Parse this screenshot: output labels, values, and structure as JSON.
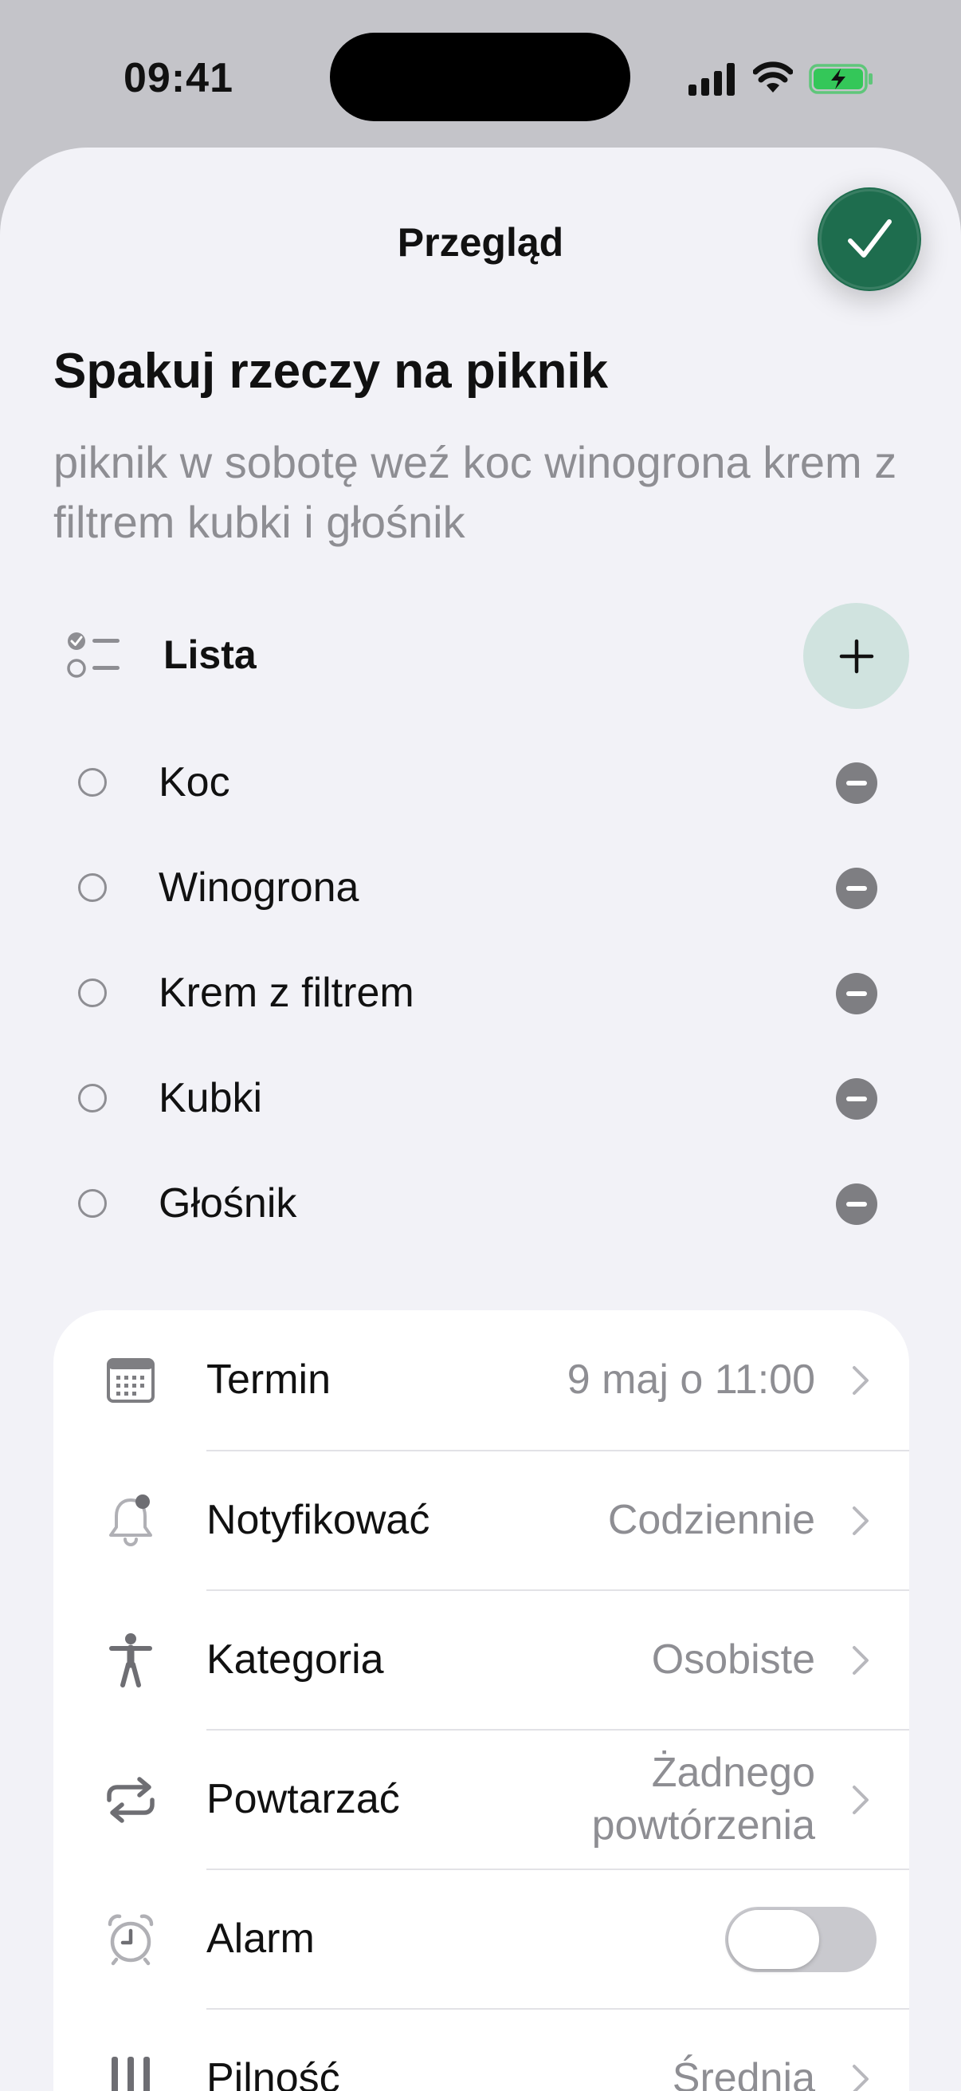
{
  "status_bar": {
    "time": "09:41"
  },
  "header": {
    "title": "Przegląd"
  },
  "task": {
    "title": "Spakuj rzeczy na piknik",
    "description": "piknik w sobotę weź koc winogrona krem z filtrem kubki i głośnik"
  },
  "list": {
    "label": "Lista",
    "items": [
      {
        "label": "Koc"
      },
      {
        "label": "Winogrona"
      },
      {
        "label": "Krem z filtrem"
      },
      {
        "label": "Kubki"
      },
      {
        "label": "Głośnik"
      }
    ]
  },
  "settings": {
    "due": {
      "label": "Termin",
      "value": "9 maj o 11:00",
      "icon": "calendar-icon"
    },
    "notify": {
      "label": "Notyfikować",
      "value": "Codziennie",
      "icon": "bell-icon"
    },
    "category": {
      "label": "Kategoria",
      "value": "Osobiste",
      "icon": "person-icon"
    },
    "repeat": {
      "label": "Powtarzać",
      "value_line1": "Żadnego",
      "value_line2": "powtórzenia",
      "icon": "repeat-icon"
    },
    "alarm": {
      "label": "Alarm",
      "enabled": false,
      "icon": "alarm-icon"
    },
    "priority": {
      "label": "Pilność",
      "value": "Średnia",
      "icon": "priority-icon"
    }
  },
  "colors": {
    "accent": "#1e6d4e",
    "add_button": "#d0e3df",
    "background": "#f2f2f7",
    "secondary_text": "#8e8e93"
  }
}
